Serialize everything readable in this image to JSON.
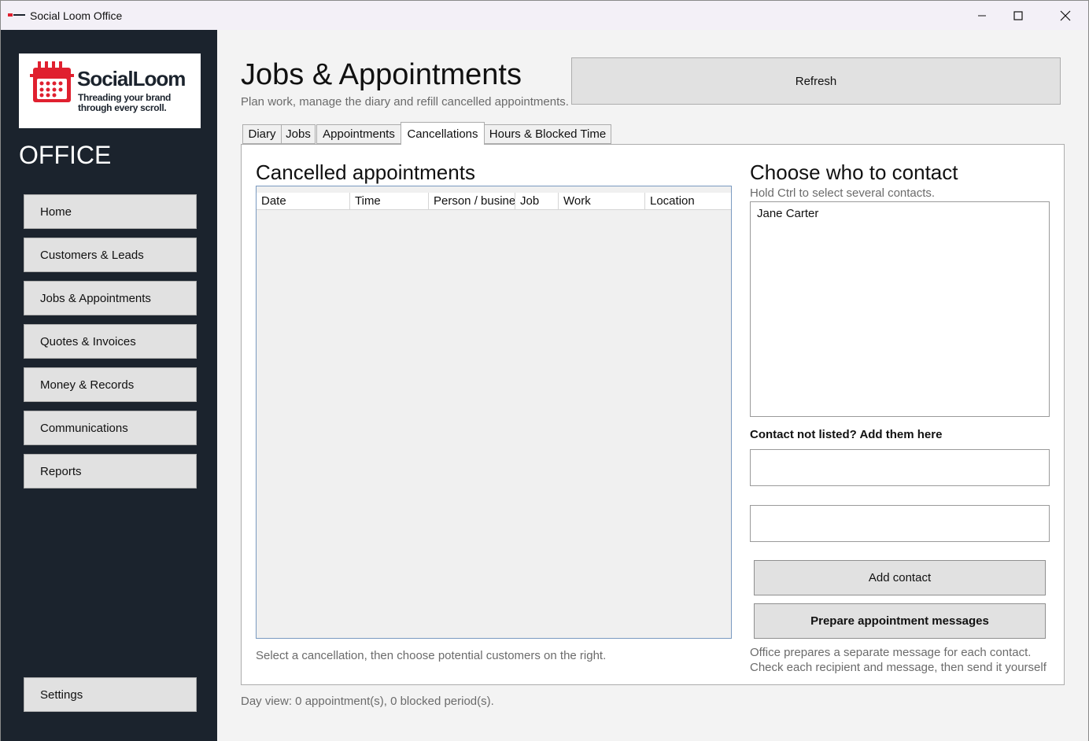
{
  "window": {
    "title": "Social Loom Office"
  },
  "sidebar": {
    "logo": {
      "name": "SocialLoom",
      "tagline_line1": "Threading your brand",
      "tagline_line2": "through every scroll."
    },
    "office_label": "OFFICE",
    "items": [
      {
        "label": "Home"
      },
      {
        "label": "Customers & Leads"
      },
      {
        "label": "Jobs & Appointments"
      },
      {
        "label": "Quotes & Invoices"
      },
      {
        "label": "Money & Records"
      },
      {
        "label": "Communications"
      },
      {
        "label": "Reports"
      }
    ],
    "settings_label": "Settings"
  },
  "header": {
    "title": "Jobs & Appointments",
    "subtitle": "Plan work, manage the diary and refill cancelled appointments.",
    "refresh_label": "Refresh"
  },
  "tabs": [
    {
      "label": "Diary",
      "active": false
    },
    {
      "label": "Jobs",
      "active": false
    },
    {
      "label": "Appointments",
      "active": false
    },
    {
      "label": "Cancellations",
      "active": true
    },
    {
      "label": "Hours & Blocked Time",
      "active": false
    }
  ],
  "cancellations": {
    "title": "Cancelled appointments",
    "columns": [
      "Date",
      "Time",
      "Person / business",
      "Job",
      "Work",
      "Location"
    ],
    "rows": [],
    "hint": "Select a cancellation, then choose potential customers on the right."
  },
  "contact": {
    "title": "Choose who to contact",
    "hint": "Hold Ctrl to select several contacts.",
    "contacts": [
      "Jane Carter"
    ],
    "add_label": "Contact not listed? Add them here",
    "input1_value": "",
    "input2_value": "",
    "add_button": "Add contact",
    "prepare_button": "Prepare appointment messages",
    "note_line1": "Office prepares a separate message for each contact.",
    "note_line2": "Check each recipient and message, then send it yourself"
  },
  "status_bar": {
    "text": "Day view: 0 appointment(s), 0 blocked period(s)."
  },
  "colors": {
    "sidebar_bg": "#1b232d",
    "brand_red": "#e0202f",
    "button_bg": "#e1e1e1"
  }
}
